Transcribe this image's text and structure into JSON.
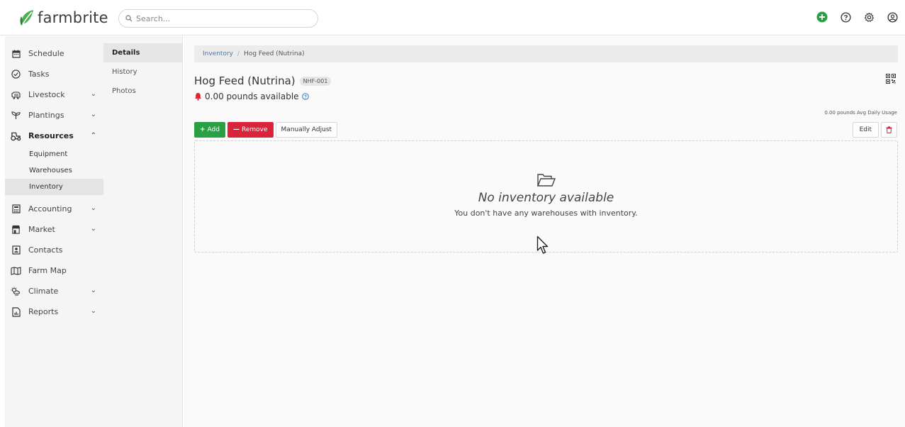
{
  "app": {
    "logo_text": "farmbrite",
    "brand_color": "#29a043"
  },
  "search": {
    "placeholder": "Search..."
  },
  "top_icons": [
    "add-circle-icon",
    "help-icon",
    "settings-gear-icon",
    "account-icon"
  ],
  "sidebar": {
    "items": [
      {
        "label": "Schedule",
        "icon": "calendar-icon",
        "expandable": false
      },
      {
        "label": "Tasks",
        "icon": "check-circle-icon",
        "expandable": false
      },
      {
        "label": "Livestock",
        "icon": "livestock-icon",
        "expandable": true
      },
      {
        "label": "Plantings",
        "icon": "sprout-icon",
        "expandable": true
      },
      {
        "label": "Resources",
        "icon": "tractor-icon",
        "expandable": true,
        "expanded": true
      },
      {
        "label": "Accounting",
        "icon": "calculator-icon",
        "expandable": true
      },
      {
        "label": "Market",
        "icon": "store-icon",
        "expandable": true
      },
      {
        "label": "Contacts",
        "icon": "contact-card-icon",
        "expandable": false
      },
      {
        "label": "Farm Map",
        "icon": "map-icon",
        "expandable": false
      },
      {
        "label": "Climate",
        "icon": "weather-icon",
        "expandable": true
      },
      {
        "label": "Reports",
        "icon": "report-icon",
        "expandable": true
      }
    ],
    "resources_sub": [
      {
        "label": "Equipment"
      },
      {
        "label": "Warehouses"
      },
      {
        "label": "Inventory",
        "active": true
      }
    ]
  },
  "subnav": {
    "items": [
      {
        "label": "Details",
        "active": true
      },
      {
        "label": "History"
      },
      {
        "label": "Photos"
      }
    ]
  },
  "breadcrumb": {
    "link": "Inventory",
    "separator": "/",
    "current": "Hog Feed (Nutrina)"
  },
  "item": {
    "title": "Hog Feed (Nutrina)",
    "code": "NHF-001",
    "available": "0.00 pounds available",
    "avg_usage": "0.00 pounds Avg Daily Usage"
  },
  "actions": {
    "add_label": "Add",
    "remove_label": "Remove",
    "adjust_label": "Manually Adjust",
    "edit_label": "Edit"
  },
  "empty_state": {
    "title": "No inventory available",
    "subtitle": "You don't have any warehouses with inventory."
  },
  "colors": {
    "add": "#29a043",
    "remove": "#d9243a",
    "alert": "#d9243a",
    "link": "#3a7abf"
  }
}
